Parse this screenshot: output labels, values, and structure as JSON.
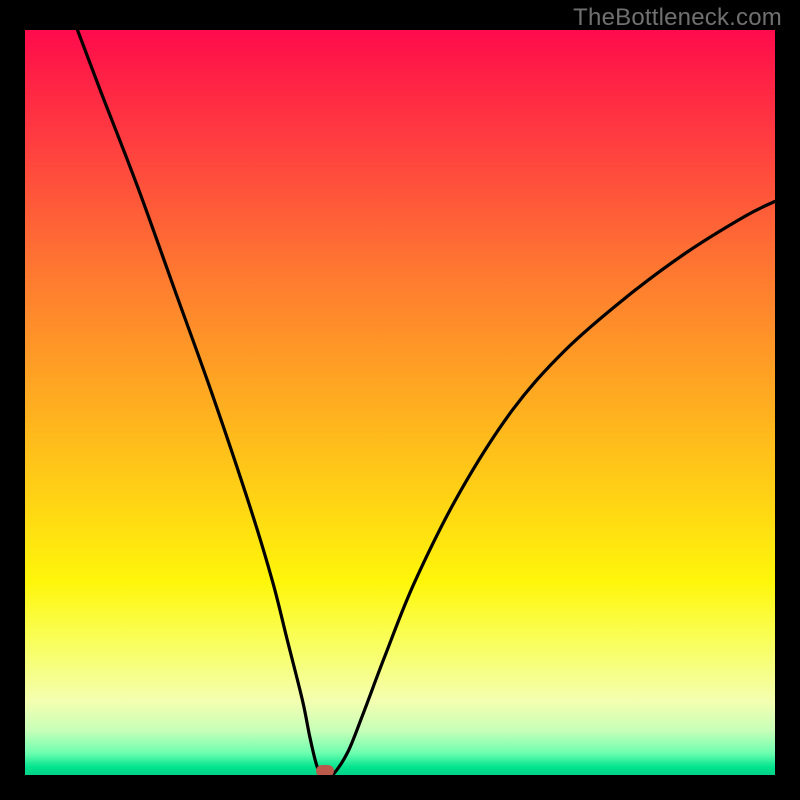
{
  "watermark": {
    "text": "TheBottleneck.com"
  },
  "colors": {
    "frame": "#000000",
    "watermark": "#707070",
    "curve": "#000000",
    "marker": "#bb5a4a",
    "gradient_stops": [
      "#ff0b4c",
      "#ff2046",
      "#ff4e3c",
      "#ff7a30",
      "#ffa423",
      "#ffd015",
      "#fff60a",
      "#f9ff5a",
      "#f4ffb0",
      "#c8ffb8",
      "#6fffb0",
      "#00e38d",
      "#00d18a"
    ]
  },
  "chart_data": {
    "type": "line",
    "title": "",
    "xlabel": "",
    "ylabel": "",
    "xlim": [
      0,
      100
    ],
    "ylim": [
      0,
      100
    ],
    "grid": false,
    "legend": false,
    "series": [
      {
        "name": "bottleneck-curve",
        "x": [
          7,
          10,
          15,
          20,
          25,
          30,
          33,
          35,
          37,
          38,
          39,
          40,
          41,
          43,
          45,
          48,
          52,
          58,
          65,
          72,
          80,
          88,
          96,
          100
        ],
        "y": [
          100,
          92,
          79,
          65,
          51,
          36,
          26,
          18,
          10,
          5,
          1,
          0,
          0,
          3,
          8,
          16,
          26,
          38,
          49,
          57,
          64,
          70,
          75,
          77
        ]
      }
    ],
    "annotations": [
      {
        "name": "optimal-marker",
        "x": 40,
        "y": 0.5
      }
    ],
    "background": {
      "type": "vertical-gradient",
      "meaning": "red-high-bottleneck-to-green-zero-bottleneck"
    }
  }
}
